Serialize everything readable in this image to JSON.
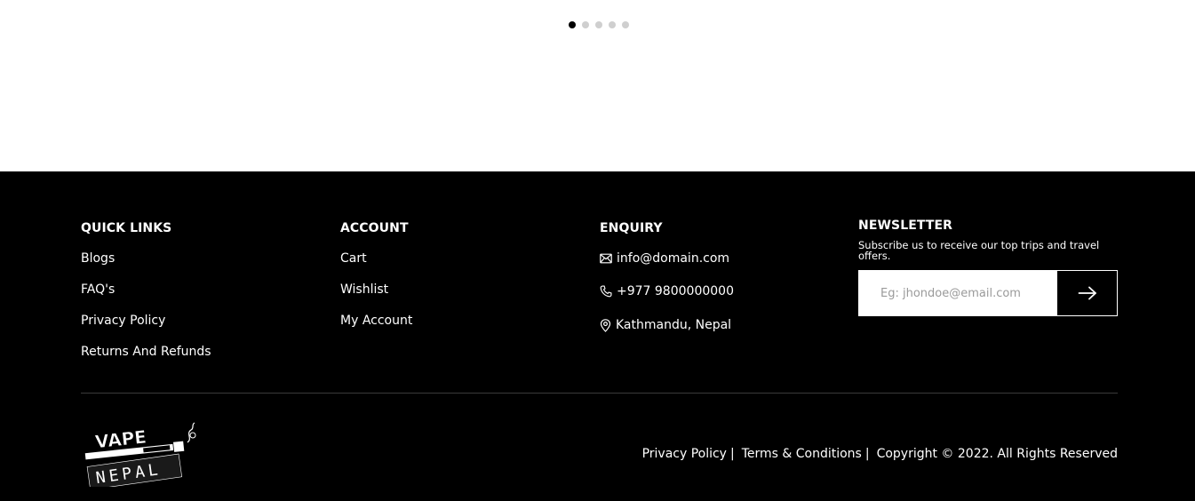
{
  "carousel": {
    "dots": [
      {
        "active": true
      },
      {
        "active": false
      },
      {
        "active": false
      },
      {
        "active": false
      },
      {
        "active": false
      }
    ]
  },
  "footer": {
    "quick_links": {
      "heading": "QUICK LINKS",
      "items": [
        "Blogs",
        "FAQ's",
        "Privacy Policy",
        "Returns And Refunds"
      ]
    },
    "account": {
      "heading": "ACCOUNT",
      "items": [
        "Cart",
        "Wishlist",
        "My Account"
      ]
    },
    "enquiry": {
      "heading": "ENQUIRY",
      "email": "info@domain.com",
      "phone": "+977 9800000000",
      "location": "Kathmandu, Nepal",
      "icons": [
        "envelope-icon",
        "phone-icon",
        "map-pin-icon"
      ]
    },
    "newsletter": {
      "heading": "NEWSLETTER",
      "description": "Subscribe us to receive our top trips and travel offers.",
      "placeholder": "Eg: jhondoe@email.com",
      "value": "",
      "submit_icon": "arrow-right-icon"
    },
    "logo": {
      "line1": "VAPE",
      "line2": "NEPAL"
    },
    "bottom": {
      "privacy": "Privacy Policy",
      "terms": "Terms & Conditions",
      "separator": "|",
      "copyright": "Copyright © 2022. All Rights Reserved"
    },
    "colors": {
      "background": "#000000",
      "text": "#ffffff",
      "dot_active": "#000000",
      "dot_inactive": "#cfcfcf"
    }
  }
}
